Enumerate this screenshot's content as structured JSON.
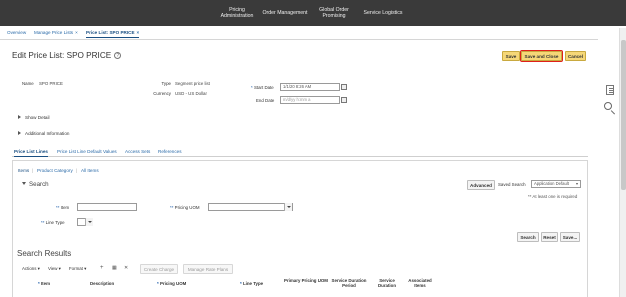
{
  "topnav": {
    "items": [
      "Pricing Administration",
      "Order Management",
      "Global Order Promising",
      "Service Logistics"
    ]
  },
  "tabs": [
    {
      "label": "Overview"
    },
    {
      "label": "Manage Price Lists",
      "close": "×"
    },
    {
      "label": "Price List: SPO PRICE",
      "close": "×"
    }
  ],
  "header": {
    "title": "Edit Price List: SPO PRICE",
    "help_icon": "?",
    "save": "Save",
    "save_and_close": "Save and Close",
    "cancel": "Cancel"
  },
  "form": {
    "name_label": "Name",
    "name_value": "SPO PRICE",
    "type_label": "Type",
    "type_value": "Segment price list",
    "currency_label": "Currency",
    "currency_value": "USD - US Dollar",
    "start_date_label": "Start Date",
    "start_date_value": "1/1/20 8:26 AM",
    "end_date_label": "End Date",
    "end_date_placeholder": "m/d/yy h:mm a",
    "required_marker": "*"
  },
  "disclosures": {
    "show_detail": "Show Detail",
    "additional_information": "Additional Information"
  },
  "subtabs": [
    "Price List Lines",
    "Price List Line Default Values",
    "Access Sets",
    "References"
  ],
  "items_nav": {
    "items": "Items",
    "product_category": "Product Category",
    "all_items": "All Items"
  },
  "search": {
    "title": "Search",
    "advanced": "Advanced",
    "saved_search_label": "Saved Search",
    "saved_search_value": "Application Default",
    "at_least_one": "** At least one is required",
    "required_double": "**",
    "item_label": "Item",
    "pricing_uom_label": "Pricing UOM",
    "line_type_label": "Line Type",
    "search_btn": "Search",
    "reset_btn": "Reset",
    "save_btn": "Save..."
  },
  "results": {
    "title": "Search Results",
    "actions": "Actions",
    "view": "View",
    "format": "Format",
    "create_charge": "Create Charge",
    "manage_rate_plans": "Manage Rate Plans",
    "columns": [
      "Item",
      "Description",
      "Pricing UOM",
      "Line Type",
      "Primary Pricing UOM",
      "Service Duration Period",
      "Service Duration",
      "Associated Items"
    ]
  },
  "icons": {
    "add": "+",
    "delete": "✕",
    "export": "▦"
  }
}
